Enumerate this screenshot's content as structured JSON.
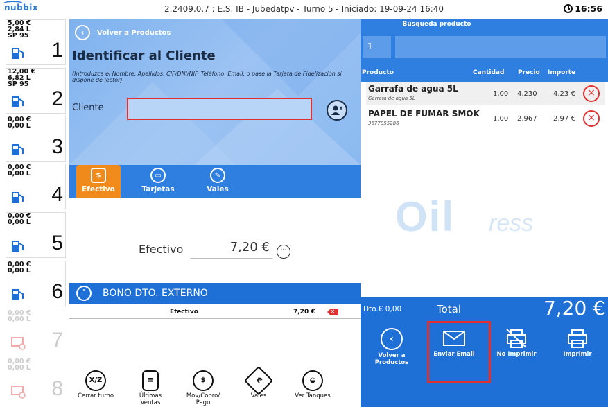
{
  "topbar": {
    "logo": "nubbix",
    "info": "2.2409.0.7 : E.S. IB  -  Jubedatpv  -  Turno 5  -  Iniciado: 19-09-24 16:40",
    "clock": "16:56"
  },
  "pumps": [
    {
      "num": "1",
      "l1": "5,00 €",
      "l2": "2,84 L",
      "l3": "SP 95",
      "enabled": true
    },
    {
      "num": "2",
      "l1": "12,00 €",
      "l2": "6,82 L",
      "l3": "SP 95",
      "enabled": true
    },
    {
      "num": "3",
      "l1": "0,00 €",
      "l2": "0,00 L",
      "l3": "",
      "enabled": true
    },
    {
      "num": "4",
      "l1": "0,00 €",
      "l2": "0,00 L",
      "l3": "",
      "enabled": true
    },
    {
      "num": "5",
      "l1": "0,00 €",
      "l2": "0,00 L",
      "l3": "",
      "enabled": true
    },
    {
      "num": "6",
      "l1": "0,00 €",
      "l2": "0,00 L",
      "l3": "",
      "enabled": true
    },
    {
      "num": "7",
      "l1": "0,00 €",
      "l2": "0,00 L",
      "l3": "",
      "enabled": false
    },
    {
      "num": "8",
      "l1": "0,00 €",
      "l2": "0,00 L",
      "l3": "",
      "enabled": false
    }
  ],
  "identify": {
    "back_label": "Volver a Productos",
    "title": "Identificar al Cliente",
    "hint": "(Introduzca el Nombre, Apellidos, CIF/DNI/NIF, Teléfono, Email, o pase la Tarjeta de Fidelización si dispone de lector).",
    "cliente_label": "Cliente",
    "cliente_value": ""
  },
  "pay_tabs": [
    {
      "label": "Efectivo",
      "icon": "cash-icon",
      "active": true
    },
    {
      "label": "Tarjetas",
      "icon": "card-icon",
      "active": false
    },
    {
      "label": "Vales",
      "icon": "voucher-icon",
      "active": false
    }
  ],
  "efectivo": {
    "label": "Efectivo",
    "value": "7,20 €"
  },
  "bono": {
    "label": "BONO DTO. EXTERNO",
    "row_method": "Efectivo",
    "row_amount": "7,20 €"
  },
  "functions": [
    {
      "label": "Cerrar turno",
      "icon": "X/Z"
    },
    {
      "label": "Últimas Ventas",
      "icon": "receipt"
    },
    {
      "label": "Mov/Cobro/ Pago",
      "icon": "money"
    },
    {
      "label": "Vales",
      "icon": "voucher"
    },
    {
      "label": "Ver Tanques",
      "icon": "tank"
    }
  ],
  "search": {
    "label": "Búsqueda producto",
    "qty": "1",
    "value": ""
  },
  "product_columns": [
    "Producto",
    "Cantidad",
    "Precio",
    "Importe"
  ],
  "products": [
    {
      "name": "Garrafa de agua 5L",
      "sub": "Garrafa de agua 5L",
      "qty": "1,00",
      "price": "4,230",
      "amount": "4,23 €"
    },
    {
      "name": "PAPEL DE FUMAR SMOK",
      "sub": "3677855286",
      "qty": "1,00",
      "price": "2,967",
      "amount": "2,97 €"
    }
  ],
  "watermark": {
    "main": "Oil",
    "suffix": "ress"
  },
  "totals": {
    "dto": "Dto.€ 0,00",
    "label": "Total",
    "value": "7,20 €"
  },
  "actions": [
    {
      "label": "Volver a Productos",
      "icon": "back-icon"
    },
    {
      "label": "Enviar Email",
      "icon": "email-icon"
    },
    {
      "label": "No Imprimir",
      "icon": "no-print-icon"
    },
    {
      "label": "Imprimir",
      "icon": "print-icon"
    }
  ],
  "colors": {
    "blue": "#2f7fe0",
    "dark_blue": "#1e6fd6",
    "orange": "#f08a1a",
    "red": "#e03030"
  }
}
